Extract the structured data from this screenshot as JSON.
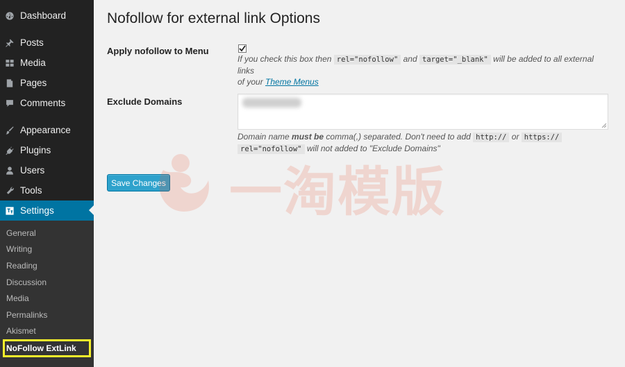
{
  "sidebar": {
    "items": [
      {
        "label": "Dashboard",
        "icon": "dashboard-icon"
      },
      {
        "label": "Posts",
        "icon": "pin-icon"
      },
      {
        "label": "Media",
        "icon": "media-icon"
      },
      {
        "label": "Pages",
        "icon": "pages-icon"
      },
      {
        "label": "Comments",
        "icon": "comment-icon"
      },
      {
        "label": "Appearance",
        "icon": "brush-icon"
      },
      {
        "label": "Plugins",
        "icon": "plug-icon"
      },
      {
        "label": "Users",
        "icon": "user-icon"
      },
      {
        "label": "Tools",
        "icon": "wrench-icon"
      },
      {
        "label": "Settings",
        "icon": "settings-icon"
      }
    ],
    "submenu": [
      "General",
      "Writing",
      "Reading",
      "Discussion",
      "Media",
      "Permalinks",
      "Akismet",
      "NoFollow ExtLink"
    ],
    "active_color": "#0074a2",
    "highlight_color": "#f3ee2b"
  },
  "main": {
    "title": "Nofollow for external link Options",
    "menu_row": {
      "label": "Apply nofollow to Menu",
      "checked": true,
      "desc_1": "If you check this box then",
      "code_1": "rel=\"nofollow\"",
      "desc_2": "and",
      "code_2": "target=\"_blank\"",
      "desc_3": "will be added to all external links",
      "desc_4": "of your",
      "link": "Theme Menus"
    },
    "exclude_row": {
      "label": "Exclude Domains",
      "desc_1": "Domain name",
      "desc_bold": "must be",
      "desc_2": "comma(,) separated. Don't need to add",
      "code_1": "http://",
      "desc_3": "or",
      "code_2": "https://",
      "code_3": "rel=\"nofollow\"",
      "desc_4": "will not added to \"Exclude Domains\""
    },
    "save_label": "Save Changes"
  },
  "watermark": {
    "text": "一淘模版",
    "color": "#e8593a"
  }
}
